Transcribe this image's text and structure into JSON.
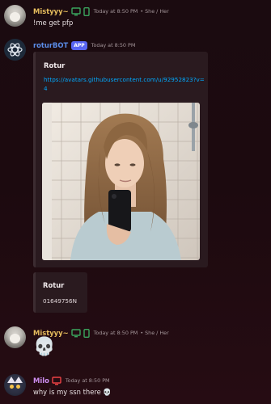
{
  "messages": [
    {
      "author": "Mistyyy~",
      "timestamp": "Today at 8:50 PM",
      "pronouns": "• She / Her",
      "text": "!me get pfp",
      "badges": [
        "monitor-icon",
        "mobile-icon"
      ]
    },
    {
      "author": "roturBOT",
      "app_tag": "APP",
      "timestamp": "Today at 8:50 PM",
      "embed": {
        "title": "Rotur",
        "link": "https://avatars.githubusercontent.com/u/92952823?v=4"
      },
      "embed2": {
        "title": "Rotur",
        "description": "01649756N"
      }
    },
    {
      "author": "Mistyyy~",
      "timestamp": "Today at 8:50 PM",
      "pronouns": "• She / Her",
      "text": "💀",
      "badges": [
        "monitor-icon",
        "mobile-icon"
      ]
    },
    {
      "author": "Milo",
      "timestamp": "Today at 8:50 PM",
      "text": "why is my ssn there 💀",
      "badges": [
        "monitor-icon"
      ]
    }
  ],
  "colors": {
    "misty_name": "#e8bf5e",
    "rotur_name": "#5b8de8",
    "milo_name": "#cd8ef0",
    "status_green": "#3ba55d",
    "status_red": "#ed4245",
    "link": "#00a8fc",
    "app_tag": "#5865f2"
  }
}
